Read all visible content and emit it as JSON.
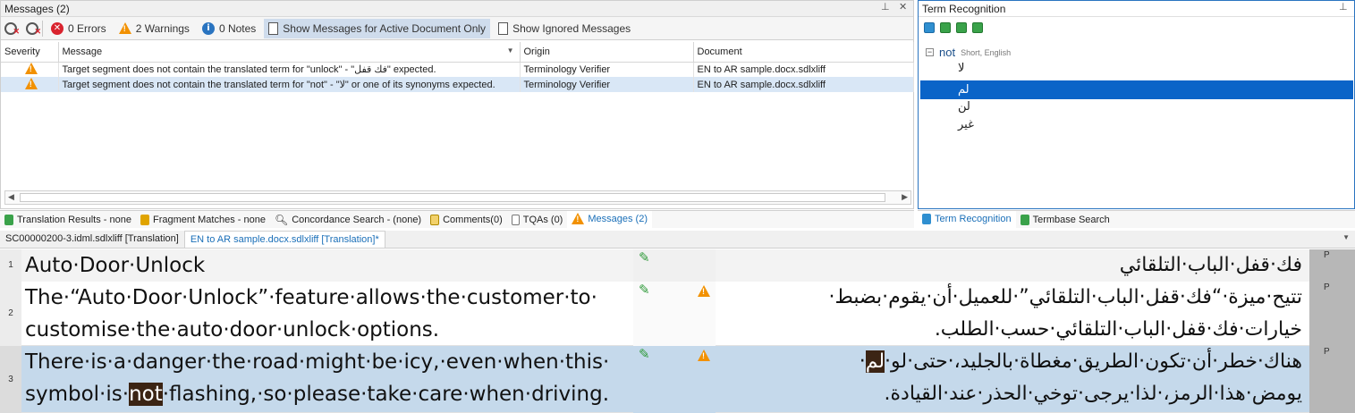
{
  "messages_panel": {
    "title": "Messages (2)",
    "toolbar": {
      "errors": "0 Errors",
      "warnings": "2 Warnings",
      "notes": "0 Notes",
      "active_doc_label": "Show Messages for Active Document Only",
      "ignored_label": "Show Ignored Messages"
    },
    "columns": [
      "Severity",
      "Message",
      "Origin",
      "Document"
    ],
    "rows": [
      {
        "message": "Target segment does not contain the translated term for \"unlock\" - \"فك قفل\" expected.",
        "origin": "Terminology Verifier",
        "document": "EN to AR sample.docx.sdlxliff"
      },
      {
        "message": "Target segment does not contain the translated term for \"not\" - \"لا\" or one of its synonyms expected.",
        "origin": "Terminology Verifier",
        "document": "EN to AR sample.docx.sdlxliff"
      }
    ]
  },
  "term_panel": {
    "title": "Term Recognition",
    "term": "not",
    "term_meta": "Short, English",
    "translations": [
      "لا",
      "لم",
      "لن",
      "غير"
    ],
    "selected_index": 1
  },
  "bottom_tabs": [
    "Translation Results - none",
    "Fragment Matches - none",
    "Concordance Search - (none)",
    "Comments(0)",
    "TQAs (0)",
    "Messages (2)"
  ],
  "right_tabs": [
    "Term Recognition",
    "Termbase Search"
  ],
  "doc_tabs": [
    "SC00000200-3.idml.sdlxliff [Translation]",
    "EN to AR sample.docx.sdlxliff [Translation]*"
  ],
  "editor": {
    "status_marker": "P",
    "rows": [
      {
        "num": "1",
        "source_line1": "Auto·Door·Unlock",
        "source_line2": "",
        "target_line1": "فك·قفل·الباب·التلقائي",
        "target_line2": ""
      },
      {
        "num": "2",
        "source_line1": "The·“Auto·Door·Unlock”·feature·allows·the·customer·to·",
        "source_line2": "customise·the·auto·door·unlock·options.",
        "target_line1": "تتيح·ميزة·“فك·قفل·الباب·التلقائي”·للعميل·أن·يقوم·بضبط·",
        "target_line2": "خيارات·فك·قفل·الباب·التلقائي·حسب·الطلب."
      },
      {
        "num": "3",
        "source_line1": "There·is·a·danger·the·road·might·be·icy,·even·when·this·",
        "source_line2_a": "symbol·is·",
        "source_line2_hl": "not",
        "source_line2_b": "·flashing,·so·please·take·care·when·driving.",
        "target_line1_a": "هناك·خطر·أن·تكون·الطريق·مغطاة·بالجليد،·حتى·لو·",
        "target_line1_hl": "لم",
        "target_line1_b": "·",
        "target_line2": "يومض·هذا·الرمز،·لذا·يرجى·توخي·الحذر·عند·القيادة."
      }
    ]
  },
  "colors": {
    "warning": "#f29100",
    "error": "#d9232e",
    "note": "#2a74c0",
    "selection": "#0a64c8",
    "row_highlight": "#c5d9eb"
  }
}
